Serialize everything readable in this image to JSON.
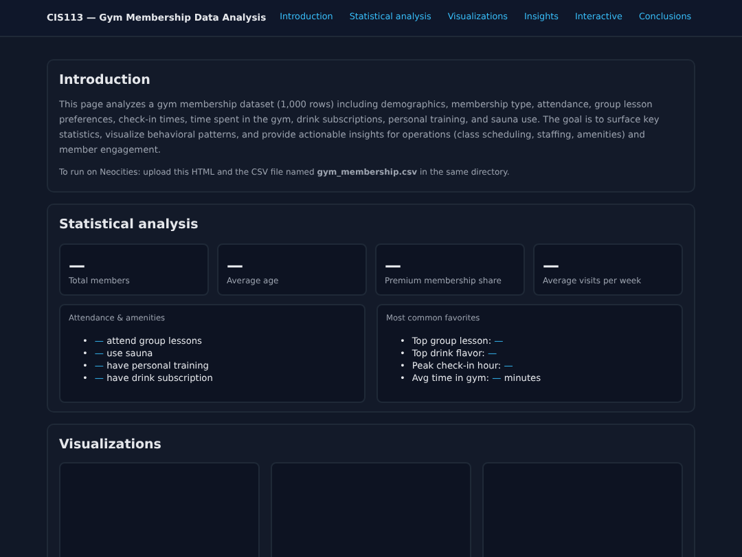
{
  "header": {
    "title": "CIS113 — Gym Membership Data Analysis",
    "nav": [
      "Introduction",
      "Statistical analysis",
      "Visualizations",
      "Insights",
      "Interactive",
      "Conclusions"
    ]
  },
  "introduction": {
    "heading": "Introduction",
    "paragraph": "This page analyzes a gym membership dataset (1,000 rows) including demographics, membership type, attendance, group lesson preferences, check-in times, time spent in the gym, drink subscriptions, personal training, and sauna use. The goal is to surface key statistics, visualize behavioral patterns, and provide actionable insights for operations (class scheduling, staffing, amenities) and member engagement.",
    "note": "To run on Neocities: upload this HTML and the CSV file named **gym_membership.csv** in the same directory."
  },
  "statistics": {
    "heading": "Statistical analysis",
    "cards": [
      {
        "value": "—",
        "label": "Total members"
      },
      {
        "value": "—",
        "label": "Average age"
      },
      {
        "value": "—",
        "label": "Premium membership share"
      },
      {
        "value": "—",
        "label": "Average visits per week"
      }
    ],
    "panels": [
      {
        "title": "Attendance & amenities",
        "items": [
          {
            "bullet": "•",
            "value": "—",
            "suffix": "attend group lessons"
          },
          {
            "bullet": "•",
            "value": "—",
            "suffix": "use sauna"
          },
          {
            "bullet": "•",
            "value": "—",
            "suffix": "have personal training"
          },
          {
            "bullet": "•",
            "value": "—",
            "suffix": "have drink subscription"
          }
        ]
      },
      {
        "title": "Most common favorites",
        "items": [
          {
            "bullet": "•",
            "prefix": "Top group lesson:",
            "value": "—"
          },
          {
            "bullet": "•",
            "prefix": "Top drink flavor:",
            "value": "—"
          },
          {
            "bullet": "•",
            "prefix": "Peak check-in hour:",
            "value": "—"
          },
          {
            "bullet": "•",
            "prefix": "Avg time in gym:",
            "value": "—",
            "suffix": "minutes"
          }
        ]
      }
    ]
  },
  "visualizations": {
    "heading": "Visualizations",
    "panels": [
      {
        "kind": "empty"
      },
      {
        "kind": "empty"
      },
      {
        "kind": "empty"
      }
    ]
  }
}
